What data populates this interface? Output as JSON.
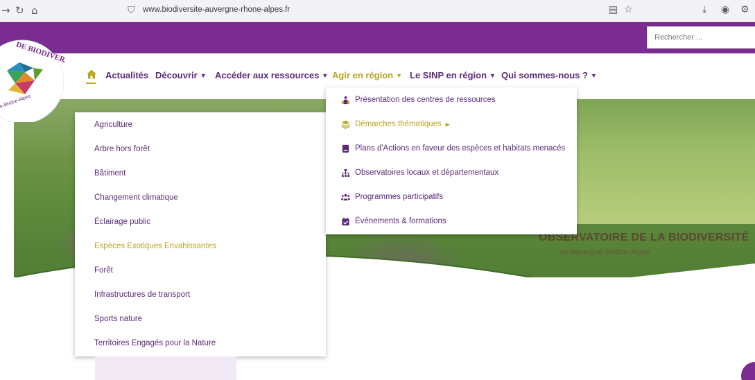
{
  "browser": {
    "url": "www.biodiversite-auvergne-rhone-alpes.fr",
    "icons": [
      "back-arrow-icon",
      "reload-icon",
      "home-icon",
      "shield-icon",
      "reader-view-icon",
      "star-icon",
      "download-icon",
      "account-icon",
      "extensions-icon"
    ]
  },
  "search": {
    "placeholder": "Rechercher ..."
  },
  "nav": {
    "home_icon": "home-icon",
    "items": [
      {
        "label": "Actualités",
        "has_caret": false
      },
      {
        "label": "Découvrir",
        "has_caret": true
      },
      {
        "label": "Accéder aux ressources",
        "has_caret": true
      },
      {
        "label": "Agir en région",
        "has_caret": true,
        "active": true
      },
      {
        "label": "Le SINP en région",
        "has_caret": true
      },
      {
        "label": "Qui sommes-nous ?",
        "has_caret": true
      }
    ],
    "caret_glyph": "▼"
  },
  "logo": {
    "text_top": "DE BIODIVERSITÉ",
    "text_bottom": "e-Rhône-Alpes"
  },
  "left_dropdown": {
    "items": [
      "Agriculture",
      "Arbre hors forêt",
      "Bâtiment",
      "Changement climatique",
      "Éclairage public",
      "Espèces Exotiques Envahissantes",
      "Forêt",
      "Infrastructures de transport",
      "Sports nature",
      "Territoires Engagés pour la Nature"
    ],
    "highlighted_index": 5
  },
  "right_dropdown": {
    "items": [
      {
        "label": "Présentation des centres de ressources",
        "icon": "people-icon"
      },
      {
        "label": "Démarches thématiques",
        "icon": "layers-icon",
        "submenu": true
      },
      {
        "label": "Plans d'Actions en faveur des espèces et habitats menacés",
        "icon": "book-icon"
      },
      {
        "label": "Observatoires locaux et départementaux",
        "icon": "sitemap-icon"
      },
      {
        "label": "Programmes participatifs",
        "icon": "users-icon"
      },
      {
        "label": "Événements & formations",
        "icon": "calendar-check-icon"
      }
    ],
    "highlighted_index": 1,
    "submenu_glyph": "▶"
  },
  "hero": {
    "title": "OBSERVATOIRE DE LA BIODIVERSITÉ",
    "title_visible": "OBSERVATOIRE DE LA BIODIVERSITÉ",
    "subtitle": "en Auvergne-Rhône-Alpes"
  },
  "colors": {
    "brand_purple": "#7a2c91",
    "nav_text": "#5d2a78",
    "accent_gold": "#b9a623",
    "hero_green": "#5d8a3c",
    "title_brown": "#5d4730"
  }
}
